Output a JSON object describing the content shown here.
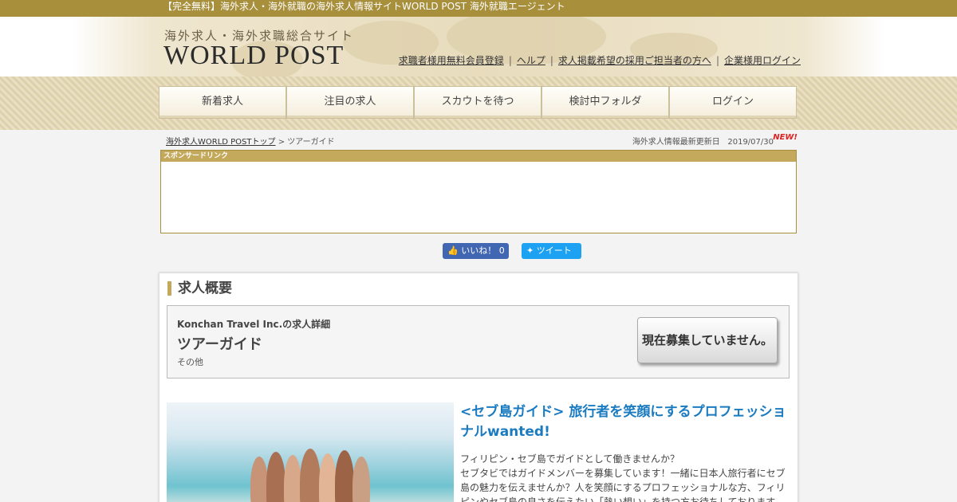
{
  "topbar": {
    "text": "【完全無料】海外求人・海外就職の海外求人情報サイトWORLD POST 海外就職エージェント"
  },
  "header": {
    "logo_sub": "海外求人・海外求職総合サイト",
    "logo_main": "WORLD POST",
    "links": [
      "求職者様用無料会員登録",
      "ヘルプ",
      "求人掲載希望の採用ご担当者の方へ",
      "企業様用ログイン"
    ],
    "separator": "|"
  },
  "nav": {
    "items": [
      "新着求人",
      "注目の求人",
      "スカウトを待つ",
      "検討中フォルダ",
      "ログイン"
    ]
  },
  "breadcrumb": {
    "home": "海外求人WORLD POSTトップ",
    "sep": ">",
    "current": "ツアーガイド"
  },
  "update": {
    "label": "海外求人情報最新更新日",
    "date": "2019/07/30",
    "badge": "NEW!"
  },
  "sponsor": {
    "label": "スポンサードリンク"
  },
  "social": {
    "like": "いいね！ 0",
    "tweet": "ツイート"
  },
  "overview": {
    "title": "求人概要",
    "company": "Konchan Travel Inc.の求人詳細",
    "job_title": "ツアーガイド",
    "category": "その他",
    "status": "現在募集していません。"
  },
  "article": {
    "headline": "<セブ島ガイド> 旅行者を笑顔にするプロフェッショナルwanted!",
    "body": "フィリピン・セブ島でガイドとして働きませんか？\nセブタビではガイドメンバーを募集しています！一緒に日本人旅行者にセブ島の魅力を伝えませんか？人を笑顔にするプロフェッショナルな方、フィリピンやセブ島の良さを伝えたい「熱い想い」を持つ方お待ちしております。"
  },
  "colors": {
    "gold": "#a88f3c",
    "link_blue": "#1a7bc0",
    "facebook": "#4267b2",
    "twitter": "#1da1f2"
  }
}
